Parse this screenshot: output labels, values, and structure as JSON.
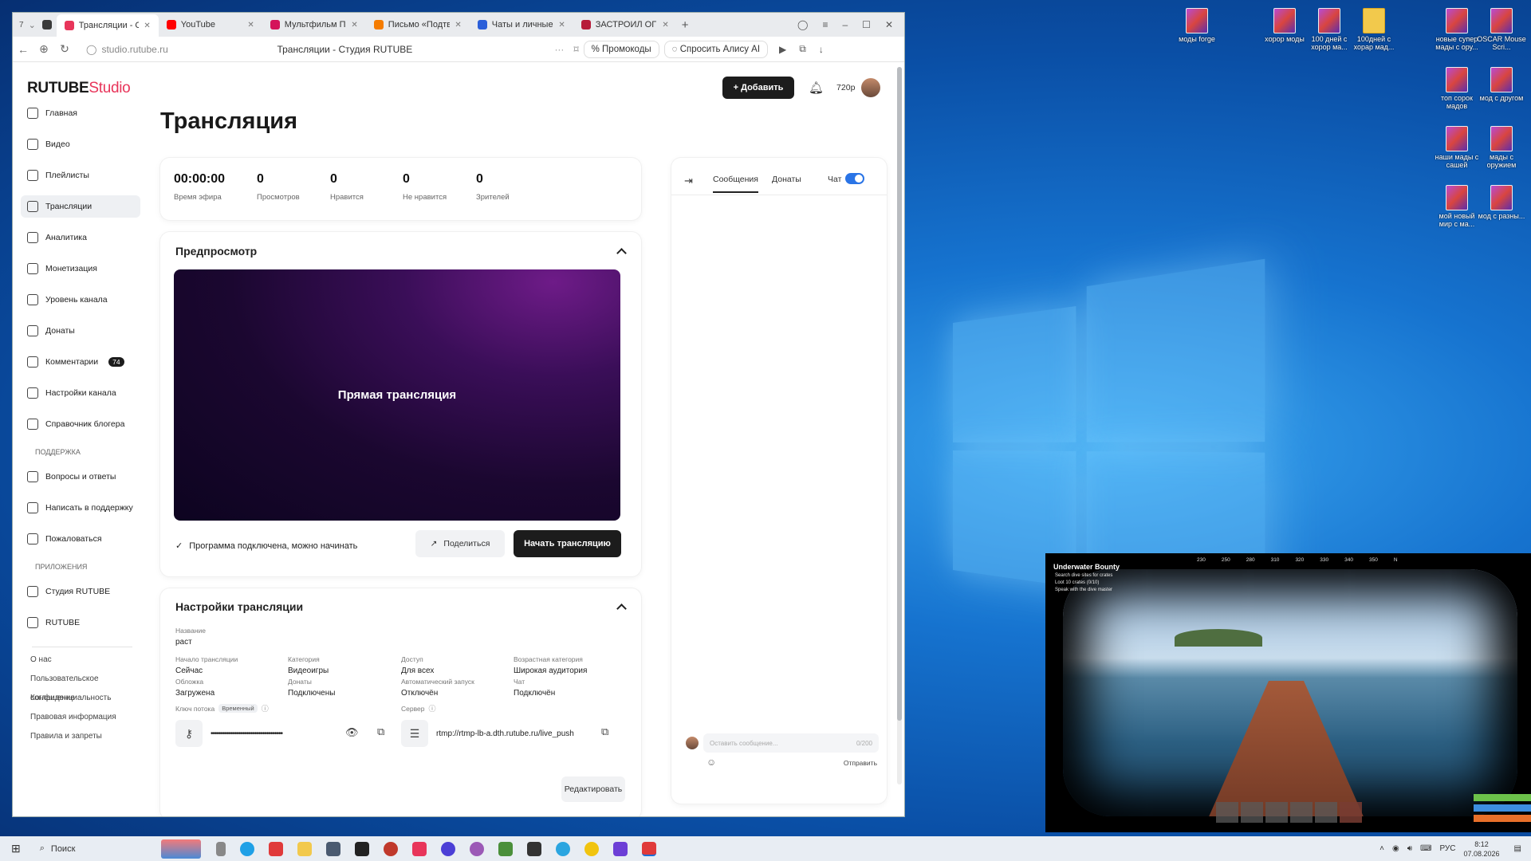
{
  "desktop": {
    "icons": [
      {
        "label": "моды forge",
        "type": "archive"
      },
      {
        "label": "хорор моды",
        "type": "archive"
      },
      {
        "label": "100 дней с хорор ма...",
        "type": "archive"
      },
      {
        "label": "100дней с хорар мад...",
        "type": "folder"
      },
      {
        "label": "новые супер мады с ору...",
        "type": "archive"
      },
      {
        "label": "OSCAR Mouse Scri...",
        "type": "archive"
      },
      {
        "label": "топ сорок мадов",
        "type": "archive"
      },
      {
        "label": "мод с другом",
        "type": "archive"
      },
      {
        "label": "наши мады с сашей",
        "type": "archive"
      },
      {
        "label": "мады с оружием",
        "type": "archive"
      },
      {
        "label": "мой новый мир с ма...",
        "type": "archive"
      },
      {
        "label": "мод с разны...",
        "type": "archive"
      }
    ]
  },
  "browser": {
    "tab_count": "7",
    "tabs": [
      {
        "label": "Трансляции - Студ",
        "color": "#e8355a",
        "active": true
      },
      {
        "label": "YouTube",
        "color": "#ff0000",
        "active": false
      },
      {
        "label": "Мультфильм Просток",
        "color": "#d4145a",
        "active": false
      },
      {
        "label": "Письмо «Подтвердит",
        "color": "#f57c00",
        "active": false
      },
      {
        "label": "Чаты и личные сообщ",
        "color": "#2b5fd9",
        "active": false
      },
      {
        "label": "ЗАСТРОИЛ ОГР",
        "color": "#b71c3a",
        "active": false
      }
    ],
    "url": "studio.rutube.ru",
    "page_title": "Трансляции - Студия RUTUBE",
    "promo_label": "Промокоды",
    "alice_label": "Спросить Алису AI"
  },
  "app": {
    "logo_main": "RUTUBE",
    "logo_sub": "Studio",
    "add_button": "Добавить",
    "quality": "720p",
    "sidebar": {
      "items": [
        {
          "label": "Главная",
          "active": false
        },
        {
          "label": "Видео",
          "active": false
        },
        {
          "label": "Плейлисты",
          "active": false
        },
        {
          "label": "Трансляции",
          "active": true
        },
        {
          "label": "Аналитика",
          "active": false
        },
        {
          "label": "Монетизация",
          "active": false
        },
        {
          "label": "Уровень канала",
          "active": false
        },
        {
          "label": "Донаты",
          "active": false
        },
        {
          "label": "Комментарии",
          "active": false,
          "badge": "74"
        },
        {
          "label": "Настройки канала",
          "active": false
        },
        {
          "label": "Справочник блогера",
          "active": false
        }
      ],
      "support_heading": "ПОДДЕРЖКА",
      "support_items": [
        "Вопросы и ответы",
        "Написать в поддержку",
        "Пожаловаться"
      ],
      "apps_heading": "ПРИЛОЖЕНИЯ",
      "apps_items": [
        "Студия RUTUBE",
        "RUTUBE"
      ],
      "footer_links": [
        "О нас",
        "Пользовательское соглашение",
        "Конфиденциальность",
        "Правовая информация",
        "Правила и запреты"
      ]
    },
    "page_title": "Трансляция",
    "stats": [
      {
        "value": "00:00:00",
        "label": "Время эфира"
      },
      {
        "value": "0",
        "label": "Просмотров"
      },
      {
        "value": "0",
        "label": "Нравится"
      },
      {
        "value": "0",
        "label": "Не нравится"
      },
      {
        "value": "0",
        "label": "Зрителей"
      }
    ],
    "preview": {
      "heading": "Предпросмотр",
      "overlay_text": "Прямая трансляция",
      "status_text": "Программа подключена, можно начинать",
      "share_button": "Поделиться",
      "start_button": "Начать трансляцию"
    },
    "settings": {
      "heading": "Настройки трансляции",
      "name_label": "Название",
      "name_value": "раст",
      "fields_row1": [
        {
          "label": "Начало трансляции",
          "value": "Сейчас"
        },
        {
          "label": "Категория",
          "value": "Видеоигры"
        },
        {
          "label": "Доступ",
          "value": "Для всех"
        },
        {
          "label": "Возрастная категория",
          "value": "Широкая аудитория"
        }
      ],
      "fields_row2": [
        {
          "label": "Обложка",
          "value": "Загружена"
        },
        {
          "label": "Донаты",
          "value": "Подключены"
        },
        {
          "label": "Автоматический запуск",
          "value": "Отключён"
        },
        {
          "label": "Чат",
          "value": "Подключён"
        }
      ],
      "key_label": "Ключ потока",
      "key_tag": "Временный",
      "key_value": "••••••••••••••••••••••••••••••••••••",
      "server_label": "Сервер",
      "server_value": "rtmp://rtmp-lb-a.dth.rutube.ru/live_push",
      "edit_button": "Редактировать"
    },
    "chat": {
      "tab_messages": "Сообщения",
      "tab_donats": "Донаты",
      "chat_toggle_label": "Чат",
      "chat_enabled": true,
      "input_placeholder": "Оставить сообщение...",
      "char_count": "0/200",
      "send_button": "Отправить"
    }
  },
  "game_overlay": {
    "quest_title": "Underwater Bounty",
    "quest_items": [
      "Search dive sites for crates",
      "Loot 10 crates (0/10)",
      "Speak with the dive master"
    ],
    "compass": [
      "230",
      "250",
      "280",
      "310",
      "320",
      "330",
      "340",
      "350",
      "N"
    ]
  },
  "taskbar": {
    "search_label": "Поиск",
    "language": "РУС",
    "time": "8:12",
    "date": "07.08.2026"
  }
}
